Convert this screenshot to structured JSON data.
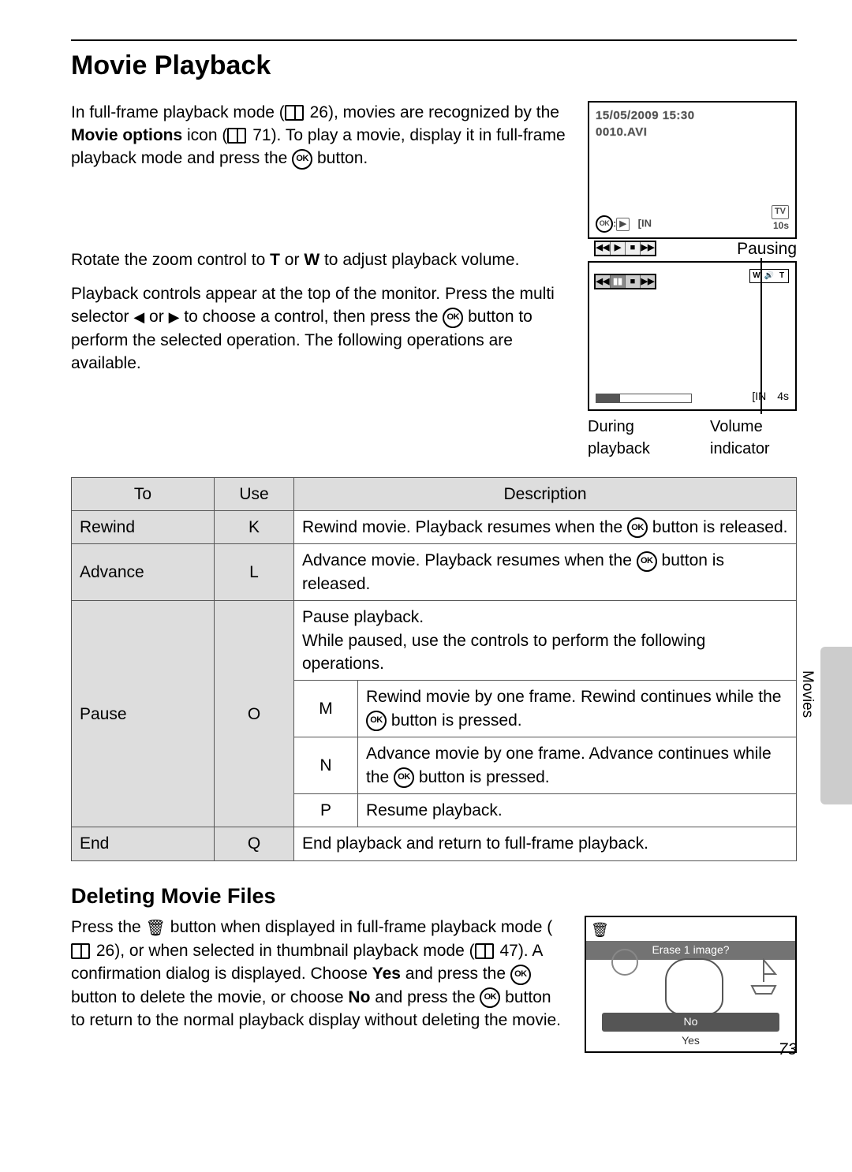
{
  "title": "Movie Playback",
  "section_label": "Movies",
  "page_number": "73",
  "intro": {
    "p1a": "In full-frame playback mode (",
    "p1_ref1": "26",
    "p1b": "), movies are recognized by the ",
    "p1_strong": "Movie options",
    "p1c": " icon (",
    "p1_ref2": "71",
    "p1d": "). To play a movie, display it in full-frame playback mode and press the ",
    "p1e": " button."
  },
  "screen1": {
    "timestamp": "15/05/2009 15:30",
    "filename": "0010.AVI",
    "ok_play": "▶",
    "mem_label": "IN",
    "tv": "TV",
    "res": "10s"
  },
  "para2a": "Rotate the zoom control to ",
  "para2_t": "T",
  "para2b": " or ",
  "para2_w": "W",
  "para2c": " to adjust playback volume.",
  "para3a": "Playback controls appear at the top of the monitor. Press the multi selector ",
  "para3b": " or ",
  "para3c": " to choose a control, then press the ",
  "para3d": " button to perform the selected operation. The following operations are available.",
  "screen2": {
    "pausing": "Pausing",
    "during": "During playback",
    "volume": "Volume indicator",
    "mem": "IN",
    "time": "4s"
  },
  "table": {
    "headers": [
      "To",
      "Use",
      "Description"
    ],
    "rows": {
      "rewind": {
        "to": "Rewind",
        "use": "K",
        "d1": "Rewind movie. Playback resumes when the ",
        "d2": " button is released."
      },
      "advance": {
        "to": "Advance",
        "use": "L",
        "d1": "Advance movie. Playback resumes when the ",
        "d2": " button is released."
      },
      "pause": {
        "to": "Pause",
        "use": "O",
        "intro": "Pause playback.\nWhile paused, use the controls to perform the following operations.",
        "m": {
          "sym": "M",
          "d1": "Rewind movie by one frame. Rewind continues while the ",
          "d2": " button is pressed."
        },
        "n": {
          "sym": "N",
          "d1": "Advance movie by one frame. Advance continues while the ",
          "d2": " button is pressed."
        },
        "p": {
          "sym": "P",
          "desc": "Resume playback."
        }
      },
      "end": {
        "to": "End",
        "use": "Q",
        "desc": "End playback and return to full-frame playback."
      }
    }
  },
  "delete": {
    "title": "Deleting Movie Files",
    "p1": "Press the ",
    "p2": " button when displayed in full-frame playback mode (",
    "ref1": "26",
    "p3": "), or when selected in thumbnail playback mode (",
    "ref2": "47",
    "p4": "). A confirmation dialog is displayed. Choose ",
    "yes": "Yes",
    "p5": " and press the ",
    "p6": " button to delete the movie, or choose ",
    "no": "No",
    "p7": " and press the ",
    "p8": " button to return to the normal playback display without deleting the movie.",
    "screen": {
      "prompt": "Erase 1 image?",
      "opt_no": "No",
      "opt_yes": "Yes"
    }
  }
}
